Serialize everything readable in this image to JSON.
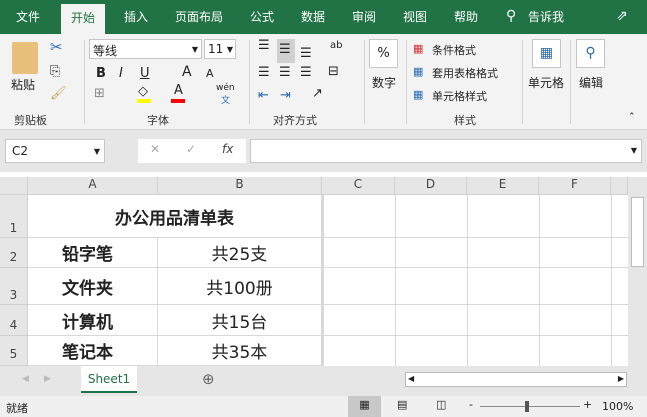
{
  "tabs": [
    "文件",
    "开始",
    "插入",
    "页面布局",
    "公式",
    "数据",
    "审阅",
    "视图",
    "帮助",
    "告诉我"
  ],
  "ribbon": {
    "paste": "粘贴",
    "clipboard": "剪贴板",
    "font_name": "等线",
    "font_size": "11",
    "bold": "B",
    "italic": "I",
    "underline": "U",
    "grow": "A",
    "shrink": "A",
    "font_group": "字体",
    "align_group": "对齐方式",
    "number": "数字",
    "percent": "%",
    "cond_format": "条件格式",
    "table_format": "套用表格格式",
    "cell_style": "单元格样式",
    "styles_group": "样式",
    "cells": "单元格",
    "edit": "编辑",
    "wen": "wén",
    "wen2": "文",
    "fill_color": "#ffff00",
    "font_color": "#ff0000"
  },
  "formula": {
    "name_box": "C2",
    "fx": "fx",
    "value": ""
  },
  "columns": [
    "A",
    "B",
    "C",
    "D",
    "E",
    "F"
  ],
  "rows": [
    "1",
    "2",
    "3",
    "4",
    "5"
  ],
  "cells": {
    "title": "办公用品清单表",
    "r2a": "铅字笔",
    "r2b": "共25支",
    "r3a": "文件夹",
    "r3b": "共100册",
    "r4a": "计算机",
    "r4b": "共15台",
    "r5a": "笔记本",
    "r5b": "共35本"
  },
  "sheet_tab": "Sheet1",
  "status": {
    "ready": "就绪",
    "zoom": "100%"
  }
}
